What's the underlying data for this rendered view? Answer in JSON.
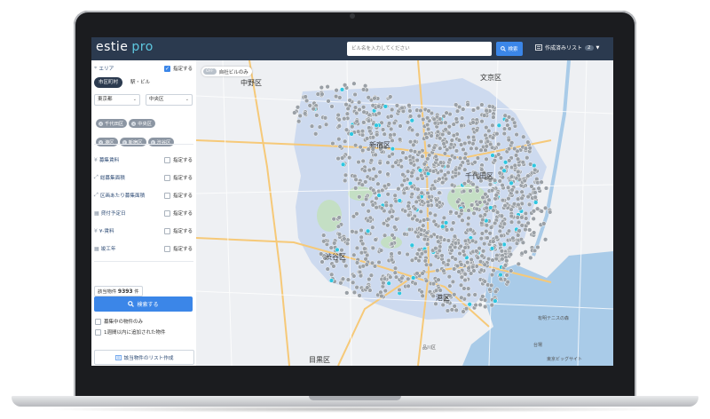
{
  "app": {
    "logo_main": "estie",
    "logo_sub": "pro"
  },
  "header": {
    "search_placeholder": "ビル名を入力してください",
    "search_button": "検索",
    "lists_label": "作成済みリスト",
    "lists_count": "2"
  },
  "sidebar": {
    "area_label": "エリア",
    "area_check": "指定する",
    "tabs": [
      "市区町村",
      "駅・ビル"
    ],
    "prefecture": "東京都",
    "ward": "中央区",
    "chips": [
      "千代田区",
      "中央区",
      "港区",
      "新宿区",
      "渋谷区"
    ],
    "filters": [
      {
        "label": "募集賃料",
        "check": "指定する"
      },
      {
        "label": "総募集面積",
        "check": "指定する"
      },
      {
        "label": "区画あたり募集面積",
        "check": "指定する"
      },
      {
        "label": "貸付予定日",
        "check": "指定する"
      },
      {
        "label": "¥-賃料",
        "check": "指定する"
      },
      {
        "label": "竣工年",
        "check": "指定する"
      }
    ],
    "result_prefix": "該当物件",
    "result_count": "9393",
    "result_suffix": "件",
    "search_button": "検索する",
    "options": [
      "募集中の物件のみ",
      "1週間以内に追加された物件"
    ],
    "list_button": "該当物件のリスト作成"
  },
  "map": {
    "toggle_state": "OFF",
    "toggle_label": "自社ビルのみ",
    "wards": [
      "中野区",
      "文京区",
      "新宿区",
      "千代田区",
      "渋谷区",
      "港区",
      "目黒区"
    ],
    "places": [
      "品川区",
      "有明テニスの森",
      "台場",
      "東京ビッグサイト"
    ]
  },
  "colors": {
    "header": "#2b3a4f",
    "accent": "#3b86e8",
    "pin": "#9aa0a6",
    "pin_highlight": "#2ec6e0",
    "ward_fill": "#c9d7ee"
  }
}
